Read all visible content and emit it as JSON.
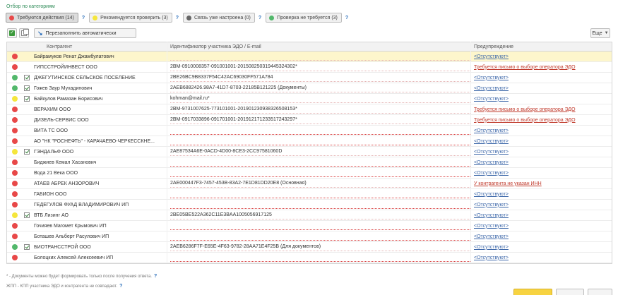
{
  "filter_title": "Отбор по категориям",
  "help_mark": "?",
  "filters": [
    {
      "label": "Требуются действия (14)",
      "color": "#e84848",
      "active": true
    },
    {
      "label": "Рекомендуется проверить (3)",
      "color": "#f5e63c",
      "active": false
    },
    {
      "label": "Связь уже настроена (0)",
      "color": "#666666",
      "active": false
    },
    {
      "label": "Проверка не требуется (3)",
      "color": "#52b86b",
      "active": false
    }
  ],
  "toolbar": {
    "refill_label": "Перезаполнить автоматически",
    "more_label": "Еще"
  },
  "columns": {
    "name": "Контрагент",
    "id": "Идентификатор участника ЭДО / E-mail",
    "warning": "Предупреждение"
  },
  "status_colors": {
    "red": "#e84848",
    "yellow": "#f5e63c",
    "green": "#52b86b"
  },
  "rows": [
    {
      "status": "red",
      "checkbox": false,
      "checked": false,
      "name": "Байрамуков Ренат Джамбулатович",
      "id": "",
      "warning": "<Отсутствуют>",
      "warning_type": "normal",
      "selected": true
    },
    {
      "status": "red",
      "checkbox": false,
      "checked": false,
      "name": "ГИПССТРОЙИНВЕСТ ООО",
      "id": "2BM-0910008357-091001001-201508250319445324302*",
      "warning": "Требуется письмо о выборе оператора ЭДО",
      "warning_type": "alert",
      "selected": false
    },
    {
      "status": "green",
      "checkbox": true,
      "checked": true,
      "name": "ДЖЕГУТИНСКОЕ СЕЛЬСКОЕ ПОСЕЛЕНИЕ",
      "id": "2BE26BC9B8337F54C42AC69030FF571A784",
      "warning": "<Отсутствуют>",
      "warning_type": "normal",
      "selected": false
    },
    {
      "status": "green",
      "checkbox": true,
      "checked": true,
      "name": "Гожев Заур Мухадинович",
      "id": "2AEB6882426.98A7-41D7-8703-22185B121225 (Документы)",
      "warning": "<Отсутствуют>",
      "warning_type": "normal",
      "selected": false
    },
    {
      "status": "yellow",
      "checkbox": true,
      "checked": true,
      "name": "Байкулов Рамазан Борисович",
      "id": "kohman@mail.ru*",
      "warning": "<Отсутствуют>",
      "warning_type": "normal",
      "selected": false
    },
    {
      "status": "red",
      "checkbox": false,
      "checked": false,
      "name": "ВЕРАХИМ ООО",
      "id": "2BM-9731007625-773101001-201901230938326508153*",
      "warning": "Требуется письмо о выборе оператора ЭДО",
      "warning_type": "alert",
      "selected": false
    },
    {
      "status": "red",
      "checkbox": false,
      "checked": false,
      "name": "ДИЗЕЛЬ-СЕРВИС ООО",
      "id": "2BM-0917033896-091701001-201912171233517243297*",
      "warning": "Требуется письмо о выборе оператора ЭДО",
      "warning_type": "alert",
      "selected": false
    },
    {
      "status": "red",
      "checkbox": false,
      "checked": false,
      "name": "ВИТА ТС ООО",
      "id": "",
      "warning": "<Отсутствуют>",
      "warning_type": "normal",
      "selected": false
    },
    {
      "status": "red",
      "checkbox": false,
      "checked": false,
      "name": "АО \"НК \"РОСНЕФТЬ\" - КАРАЧАЕВО-ЧЕРКЕССКНЕ...",
      "id": "",
      "warning": "<Отсутствуют>",
      "warning_type": "normal",
      "selected": false
    },
    {
      "status": "yellow",
      "checkbox": true,
      "checked": true,
      "name": "ГЭНДАЛЬФ ООО",
      "id": "2AE87534A6E-0ACD-4D00-8CE3-2CC97581060D",
      "warning": "<Отсутствуют>",
      "warning_type": "normal",
      "selected": false
    },
    {
      "status": "red",
      "checkbox": false,
      "checked": false,
      "name": "Биджиев Кемал Хасанович",
      "id": "",
      "warning": "<Отсутствуют>",
      "warning_type": "normal",
      "selected": false
    },
    {
      "status": "red",
      "checkbox": false,
      "checked": false,
      "name": "Вода 21 Века ООО",
      "id": "",
      "warning": "<Отсутствуют>",
      "warning_type": "normal",
      "selected": false
    },
    {
      "status": "red",
      "checkbox": false,
      "checked": false,
      "name": "АТАЕВ АБРЕК АНЗОРОВИЧ",
      "id": "2AE000447F3-7457-453B-83A2-7E1D81DD20E8 (Основная)",
      "warning": "У контрагента не указан ИНН",
      "warning_type": "alert",
      "selected": false
    },
    {
      "status": "red",
      "checkbox": false,
      "checked": false,
      "name": "ГАБИОН ООО",
      "id": "",
      "warning": "<Отсутствуют>",
      "warning_type": "normal",
      "selected": false
    },
    {
      "status": "red",
      "checkbox": false,
      "checked": false,
      "name": "ГЕДЕГУЛОВ ФУАД ВЛАДИМИРОВИЧ ИП",
      "id": "",
      "warning": "<Отсутствуют>",
      "warning_type": "normal",
      "selected": false
    },
    {
      "status": "yellow",
      "checkbox": true,
      "checked": true,
      "name": "ВТБ Лизинг АО",
      "id": "2BE05BE522A362C11E3BAA1005056917125",
      "warning": "<Отсутствуют>",
      "warning_type": "normal",
      "selected": false
    },
    {
      "status": "red",
      "checkbox": false,
      "checked": false,
      "name": "Гочияев Магомет Крымович ИП",
      "id": "",
      "warning": "<Отсутствуют>",
      "warning_type": "normal",
      "selected": false
    },
    {
      "status": "red",
      "checkbox": false,
      "checked": false,
      "name": "Боташев Альберт Расулович ИП",
      "id": "",
      "warning": "<Отсутствуют>",
      "warning_type": "normal",
      "selected": false
    },
    {
      "status": "green",
      "checkbox": true,
      "checked": true,
      "name": "БИОТРАНССТРОЙ ООО",
      "id": "2AEB6286F7F-E65E-4F63-9782-28AA71E4F25B (Для документов)",
      "warning": "<Отсутствуют>",
      "warning_type": "normal",
      "selected": false
    },
    {
      "status": "red",
      "checkbox": false,
      "checked": false,
      "name": "Болоцких Алексей Алексеевич ИП",
      "id": "",
      "warning": "<Отсутствуют>",
      "warning_type": "normal",
      "selected": false
    }
  ],
  "notes": [
    "* - Документы можно будет формировать только после получения ответа.",
    "ЖПП - КПП участника ЭДО и контрагента не совпадают."
  ]
}
